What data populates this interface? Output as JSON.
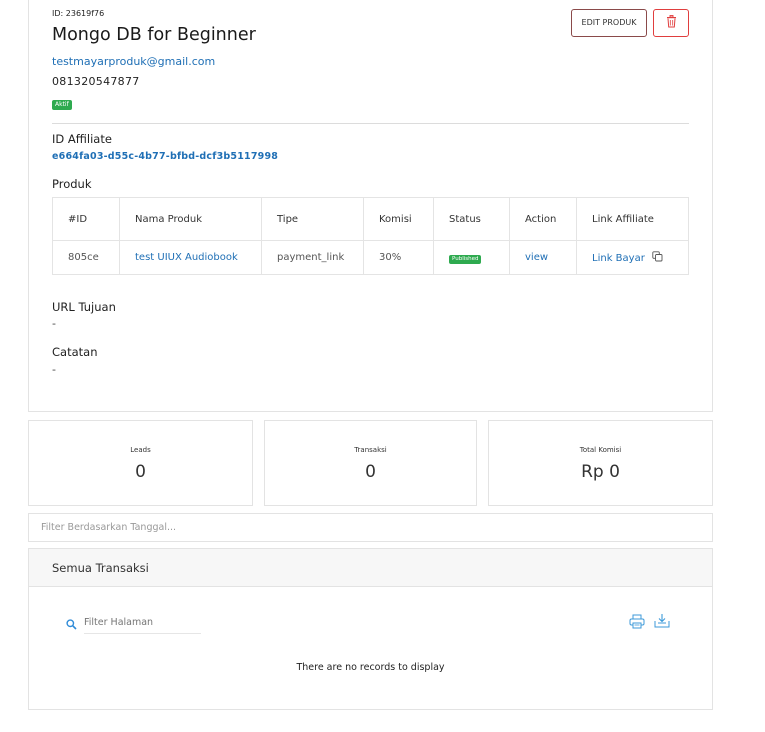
{
  "product": {
    "id_line": "ID: 23619f76",
    "title": "Mongo DB for Beginner",
    "email": "testmayarproduk@gmail.com",
    "phone": "081320547877",
    "status_badge": "Aktif",
    "edit_button": "EDIT PRODUK"
  },
  "affiliate": {
    "label": "ID Affiliate",
    "id": "e664fa03-d55c-4b77-bfbd-dcf3b5117998"
  },
  "produk_section": {
    "label": "Produk",
    "columns": [
      "#ID",
      "Nama Produk",
      "Tipe",
      "Komisi",
      "Status",
      "Action",
      "Link Affiliate"
    ],
    "row": {
      "id": "805ce",
      "name": "test UIUX Audiobook",
      "type": "payment_link",
      "commission": "30%",
      "status": "Published",
      "action": "view",
      "link": "Link Bayar"
    }
  },
  "url_tujuan": {
    "label": "URL Tujuan",
    "value": "-"
  },
  "catatan": {
    "label": "Catatan",
    "value": "-"
  },
  "stats": {
    "leads_label": "Leads",
    "leads_value": "0",
    "transaksi_label": "Transaksi",
    "transaksi_value": "0",
    "komisi_label": "Total Komisi",
    "komisi_value": "Rp 0"
  },
  "filter": {
    "placeholder": "Filter Berdasarkan Tanggal..."
  },
  "transactions": {
    "title": "Semua Transaksi",
    "search_placeholder": "Filter Halaman",
    "empty_message": "There are no records to display"
  },
  "colors": {
    "link": "#1f6fb5",
    "success": "#2eaa4f",
    "danger": "#e03e3e"
  }
}
